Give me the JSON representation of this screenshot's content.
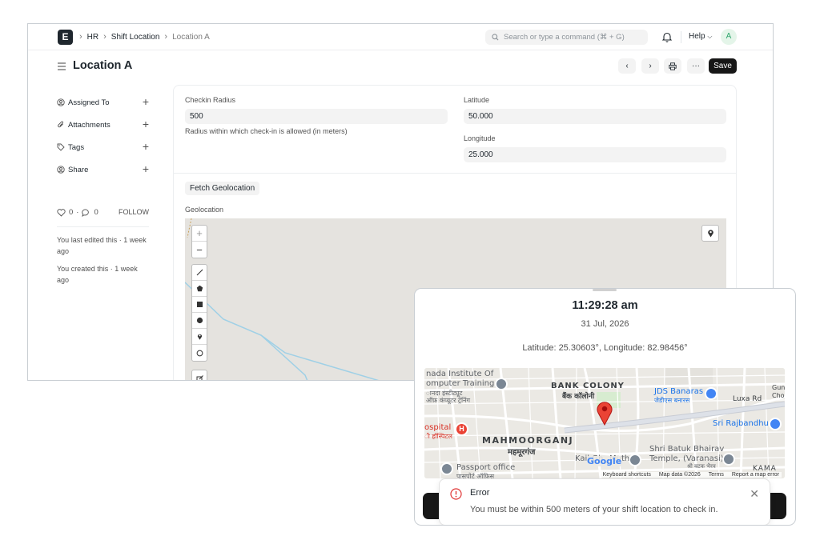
{
  "navbar": {
    "breadcrumbs": [
      "HR",
      "Shift Location",
      "Location A"
    ],
    "search_placeholder": "Search or type a command (⌘ + G)",
    "help_label": "Help",
    "avatar_initial": "A"
  },
  "page": {
    "title": "Location A",
    "save_label": "Save"
  },
  "sidebar": {
    "items": [
      {
        "label": "Assigned To",
        "icon": "user-circle-icon"
      },
      {
        "label": "Attachments",
        "icon": "paperclip-icon"
      },
      {
        "label": "Tags",
        "icon": "tag-icon"
      },
      {
        "label": "Share",
        "icon": "share-user-icon"
      }
    ],
    "likes": "0",
    "comments": "0",
    "follow_label": "FOLLOW",
    "last_edited": "You last edited this · 1 week ago",
    "created": "You created this · 1 week ago"
  },
  "form": {
    "checkin_radius_label": "Checkin Radius",
    "checkin_radius_value": "500",
    "checkin_radius_desc": "Radius within which check-in is allowed (in meters)",
    "latitude_label": "Latitude",
    "latitude_value": "50.000",
    "longitude_label": "Longitude",
    "longitude_value": "25.000",
    "fetch_label": "Fetch Geolocation",
    "geolocation_label": "Geolocation"
  },
  "dialog": {
    "time": "11:29:28 am",
    "date": "31 Jul, 2026",
    "coords": "Latitude: 25.30603°, Longitude: 82.98456°",
    "map_labels": {
      "institute_1": "nada Institute Of",
      "institute_2": "omputer Training",
      "institute_3": "ानदा इंस्टीट्यूट",
      "institute_4": "ऑफ़ कंप्यूटर ट्रेनिंग",
      "bank_colony": "BANK COLONY",
      "bank_colony_hi": "बैंक कॉलोनी",
      "jds": "JDS Banaras",
      "jds_hi": "जेडीएस बनारस",
      "luxa": "Luxa Rd",
      "rajbandhu": "Sri Rajbandhu",
      "hospital": "ospital",
      "hospital_hi": "ी हॉस्पिटल",
      "mahmoorganj": "MAHMOORGANJ",
      "mahmoorganj_hi": "महमूरगंज",
      "batuk_1": "Shri Batuk Bhairav",
      "batuk_2": "Temple, (Varanasi)",
      "batuk_hi": "श्री बटक भैरव",
      "kail": "Kail Gh",
      "math": "Muth",
      "passport": "Passport office",
      "passport_hi": "पासपोर्ट ऑफ़िस",
      "gun": "Gun",
      "chor": "Chor",
      "kama": "KAMA",
      "google": "Google"
    },
    "map_footer": {
      "shortcuts": "Keyboard shortcuts",
      "data": "Map data ©2026",
      "terms": "Terms",
      "report": "Report a map error"
    }
  },
  "toast": {
    "title": "Error",
    "message": "You must be within 500 meters of your shift location to check in."
  },
  "colors": {
    "primary_dark": "#171717",
    "error": "#e03636",
    "map_pin": "#ea4335",
    "poi_blue": "#4285f4",
    "avatar_green": "#30a66d"
  }
}
